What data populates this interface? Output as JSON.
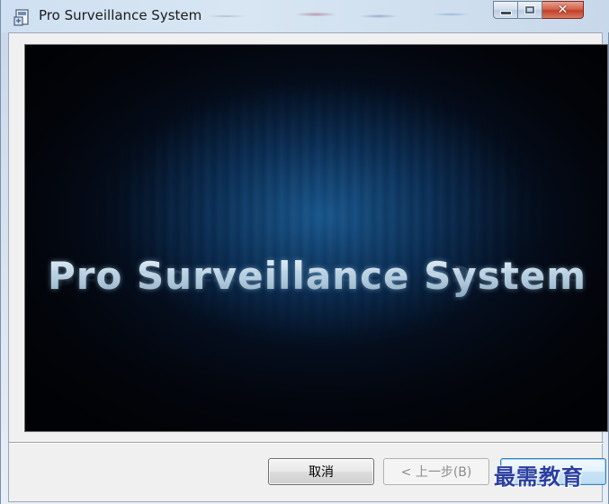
{
  "window": {
    "title": "Pro Surveillance System",
    "caption_buttons": {
      "minimize_icon": "minimize-icon",
      "maximize_icon": "maximize-icon",
      "close_icon": "close-icon",
      "close_glyph": "✕"
    }
  },
  "banner": {
    "product_name": "Pro Surveillance System"
  },
  "buttons": {
    "cancel_label": "取消",
    "back_label": "< 上一步(B)",
    "next_label": ""
  },
  "watermark": {
    "text": "最需教育"
  },
  "colors": {
    "banner_background": "#040812",
    "banner_glow": "#18568c",
    "watermark": "#2b3fa0",
    "close_button": "#c2402a"
  }
}
